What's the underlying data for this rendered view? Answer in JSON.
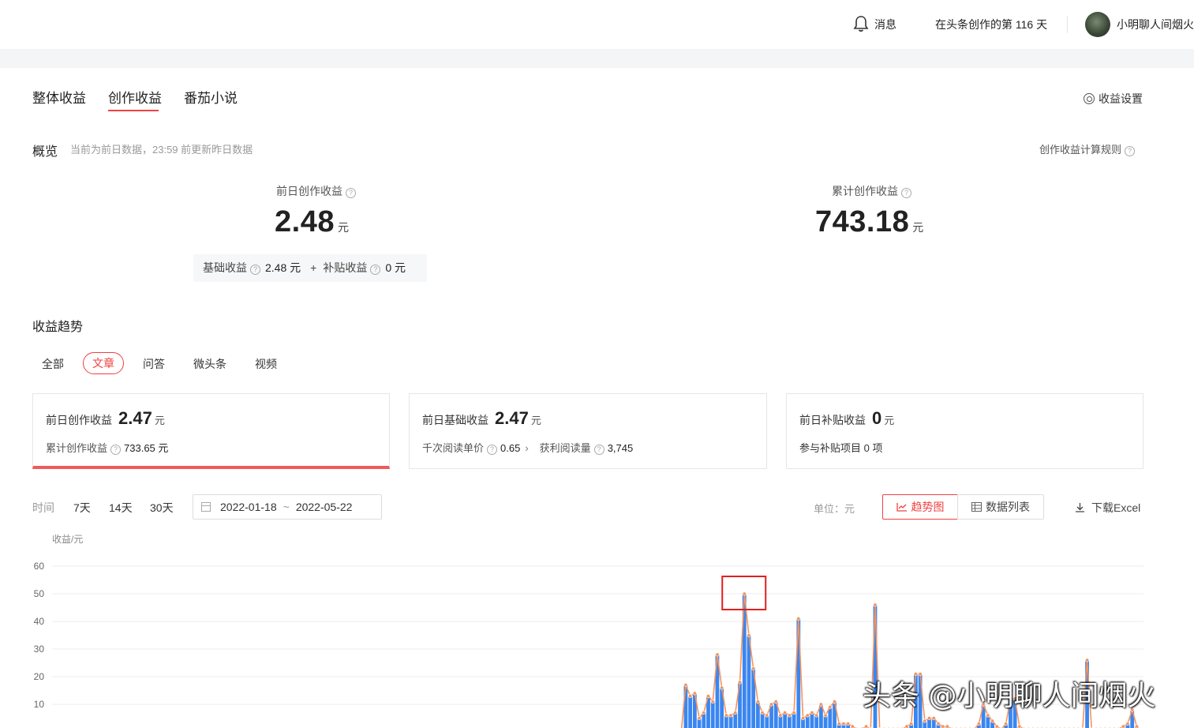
{
  "header": {
    "messages_label": "消息",
    "days_text": "在头条创作的第 116 天",
    "username": "小明聊人间烟火"
  },
  "tabs": [
    "整体收益",
    "创作收益",
    "番茄小说"
  ],
  "active_tab": "创作收益",
  "settings_label": "收益设置",
  "overview": {
    "title": "概览",
    "note": "当前为前日数据，23:59 前更新昨日数据",
    "rules_link": "创作收益计算规则",
    "yesterday": {
      "label": "前日创作收益",
      "value": "2.48",
      "unit": "元"
    },
    "total": {
      "label": "累计创作收益",
      "value": "743.18",
      "unit": "元"
    },
    "breakdown": {
      "base_label": "基础收益",
      "base_value": "2.48 元",
      "plus": "+",
      "subsidy_label": "补贴收益",
      "subsidy_value": "0 元"
    }
  },
  "trend": {
    "title": "收益趋势",
    "filters": [
      "全部",
      "文章",
      "问答",
      "微头条",
      "视频"
    ],
    "active_filter": "文章"
  },
  "cards": [
    {
      "label": "前日创作收益",
      "value": "2.47",
      "unit": "元",
      "sub_label": "累计创作收益",
      "sub_value": "733.65 元"
    },
    {
      "label": "前日基础收益",
      "value": "2.47",
      "unit": "元",
      "sub_label": "千次阅读单价",
      "sub_value": "0.65",
      "sub2_label": "获利阅读量",
      "sub2_value": "3,745"
    },
    {
      "label": "前日补贴收益",
      "value": "0",
      "unit": "元",
      "sub_label": "参与补贴项目 0 项"
    }
  ],
  "toolbar": {
    "time_label": "时间",
    "ranges": [
      "7天",
      "14天",
      "30天"
    ],
    "date_start": "2022-01-18",
    "date_sep": "~",
    "date_end": "2022-05-22",
    "unit_label": "单位：元",
    "trend_button": "趋势图",
    "list_button": "数据列表",
    "excel_button": "下载Excel"
  },
  "watermark": "头条 @小明聊人间烟火",
  "colors": {
    "accent": "#f04142",
    "bar": "#3a86f0",
    "line": "#f5935c"
  },
  "chart_data": {
    "type": "bar",
    "ylabel": "收益/元",
    "yticks": [
      10,
      20,
      30,
      40,
      50,
      60
    ],
    "ylim": [
      0,
      60
    ],
    "x": [
      "2022-01-18",
      "2022-05-22"
    ],
    "values": [
      0,
      0,
      0,
      0,
      0,
      0,
      0,
      0,
      0,
      0,
      0,
      0,
      0,
      0,
      0,
      0,
      0,
      0,
      0,
      0,
      0,
      0,
      0,
      0,
      0,
      0,
      0,
      0,
      0,
      0,
      0,
      0,
      0,
      0,
      0,
      0,
      0,
      0,
      0,
      0,
      0,
      0,
      0,
      0,
      0,
      0,
      0,
      0,
      0,
      0,
      0,
      0,
      0,
      0,
      0,
      0,
      0,
      0,
      0,
      0,
      0,
      0,
      0,
      0,
      0,
      0,
      0,
      0,
      0,
      0,
      0,
      0,
      0,
      0,
      0,
      0,
      0,
      0,
      0,
      0,
      0,
      0,
      0,
      0,
      0,
      0,
      0,
      0,
      0,
      0,
      0,
      0,
      0,
      0,
      0,
      0,
      0,
      0,
      0,
      0,
      0,
      0,
      0,
      0,
      0,
      0,
      0,
      0,
      0,
      0,
      0,
      0,
      0,
      0,
      0,
      0,
      0,
      0,
      0,
      0,
      0,
      0,
      0,
      0,
      0,
      0,
      0,
      0,
      0,
      0,
      0,
      0,
      0,
      0,
      0,
      0,
      0,
      0,
      0,
      0,
      17,
      13,
      14,
      5,
      7,
      13,
      11,
      28,
      16,
      6,
      6,
      7,
      18,
      50,
      35,
      23,
      11,
      7,
      6,
      10,
      11,
      6,
      7,
      6,
      7,
      41,
      5,
      6,
      7,
      6,
      10,
      6,
      9,
      11,
      3,
      3,
      3,
      2,
      1,
      1,
      2,
      1,
      46,
      1,
      1,
      1,
      1,
      1,
      1,
      2,
      3,
      21,
      21,
      4,
      5,
      5,
      3,
      2,
      2,
      1,
      1,
      1,
      1,
      1,
      1,
      3,
      10,
      6,
      4,
      2,
      1,
      3,
      12,
      12,
      2,
      1,
      1,
      1,
      1,
      1,
      1,
      1,
      1,
      1,
      1,
      1,
      1,
      1,
      1,
      26,
      1,
      1,
      1,
      1,
      1,
      1,
      1,
      2,
      3,
      8,
      2,
      0
    ],
    "highlight_index": 153
  }
}
